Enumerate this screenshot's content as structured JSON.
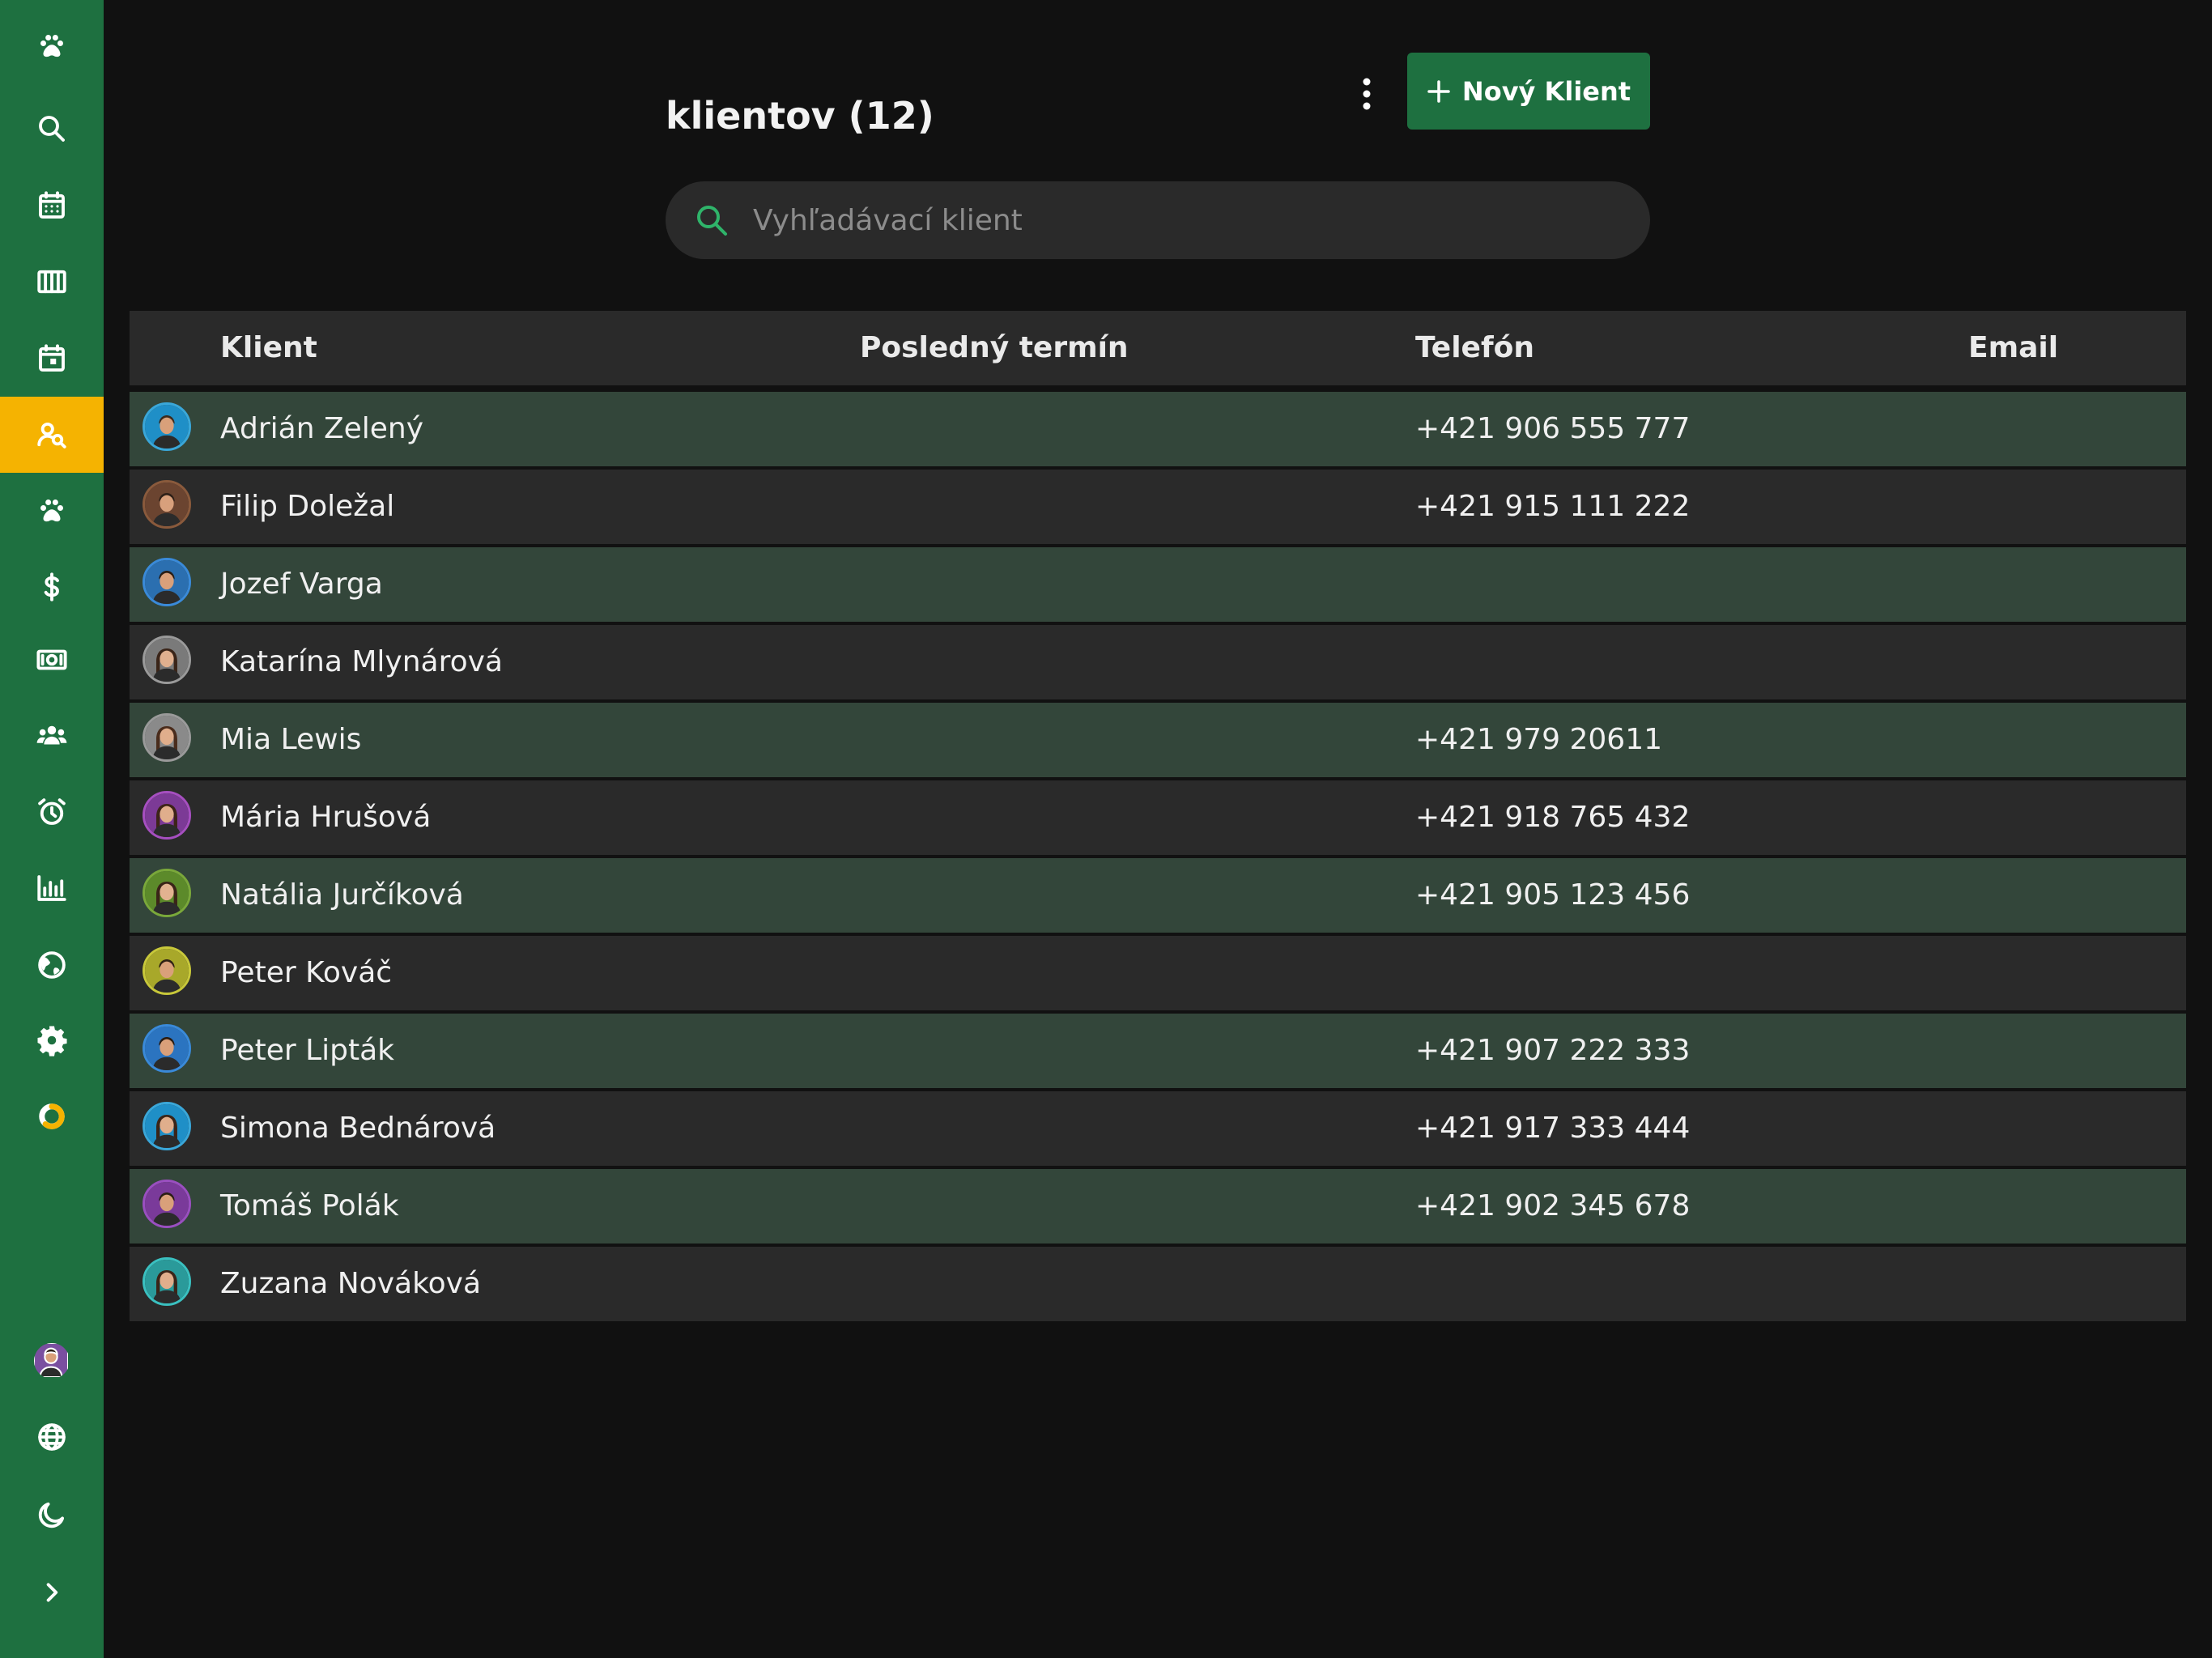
{
  "header": {
    "title": "klientov (12)",
    "new_button_label": "Nový Klient"
  },
  "search": {
    "placeholder": "Vyhľadávací klient",
    "value": ""
  },
  "sidebar": {
    "items": [
      {
        "name": "paw-logo-icon"
      },
      {
        "name": "search-icon"
      },
      {
        "name": "calendar-icon"
      },
      {
        "name": "columns-icon"
      },
      {
        "name": "calendar-day-icon"
      },
      {
        "name": "clients-icon",
        "active": true
      },
      {
        "name": "paw-icon"
      },
      {
        "name": "dollar-icon"
      },
      {
        "name": "money-bill-icon"
      },
      {
        "name": "users-icon"
      },
      {
        "name": "alarm-clock-icon"
      },
      {
        "name": "bar-chart-icon"
      },
      {
        "name": "globe-icon"
      },
      {
        "name": "gear-icon"
      },
      {
        "name": "donut-icon"
      },
      {
        "name": "user-avatar"
      },
      {
        "name": "language-globe-icon"
      },
      {
        "name": "moon-icon"
      },
      {
        "name": "expand-chevron-icon"
      }
    ],
    "active_color": "#f5b301",
    "background_color": "#1e7040"
  },
  "table": {
    "columns": [
      "Klient",
      "Posledný termín",
      "Telefón",
      "Email"
    ],
    "rows": [
      {
        "name": "Adrián Zelený",
        "last": "",
        "phone": "+421 906 555 777",
        "email": "",
        "ring": "#3aa7d9",
        "bg": "#1f8fc7",
        "skin": "#d9a07a",
        "hair": "#3b2a1e",
        "female": false
      },
      {
        "name": "Filip Doležal",
        "last": "",
        "phone": "+421 915 111 222",
        "email": "",
        "ring": "#8a5a3c",
        "bg": "#6b4430",
        "skin": "#d8a07c",
        "hair": "#2e2018",
        "female": false
      },
      {
        "name": "Jozef Varga",
        "last": "",
        "phone": "",
        "email": "",
        "ring": "#3a8ad9",
        "bg": "#2b6fb0",
        "skin": "#d9a07a",
        "hair": "#2a1d14",
        "female": false
      },
      {
        "name": "Katarína Mlynárová",
        "last": "",
        "phone": "",
        "email": "",
        "ring": "#9a9a9a",
        "bg": "#7a7a7a",
        "skin": "#e0b08f",
        "hair": "#3a2418",
        "female": true
      },
      {
        "name": "Mia Lewis",
        "last": "",
        "phone": "+421 979 20611",
        "email": "",
        "ring": "#9a9a9a",
        "bg": "#8a8a8a",
        "skin": "#e0ae8c",
        "hair": "#4a2c1c",
        "female": true
      },
      {
        "name": "Mária Hrušová",
        "last": "",
        "phone": "+421 918 765 432",
        "email": "",
        "ring": "#a64fc0",
        "bg": "#7c3a96",
        "skin": "#e0ae8c",
        "hair": "#3d2418",
        "female": true
      },
      {
        "name": "Natália Jurčíková",
        "last": "",
        "phone": "+421 905 123 456",
        "email": "",
        "ring": "#7aa83a",
        "bg": "#5c8a2a",
        "skin": "#e2b290",
        "hair": "#3a2418",
        "female": true
      },
      {
        "name": "Peter Kováč",
        "last": "",
        "phone": "",
        "email": "",
        "ring": "#c8c83a",
        "bg": "#a8a82a",
        "skin": "#d9a07a",
        "hair": "#2f2014",
        "female": false
      },
      {
        "name": "Peter Lipták",
        "last": "",
        "phone": "+421 907 222 333",
        "email": "",
        "ring": "#3a8ad9",
        "bg": "#2b74c0",
        "skin": "#d9a07a",
        "hair": "#2a1d14",
        "female": false
      },
      {
        "name": "Simona Bednárová",
        "last": "",
        "phone": "+421 917 333 444",
        "email": "",
        "ring": "#3aa7d9",
        "bg": "#1f8fc7",
        "skin": "#e0ae8c",
        "hair": "#3a2418",
        "female": true
      },
      {
        "name": "Tomáš Polák",
        "last": "",
        "phone": "+421 902 345 678",
        "email": "",
        "ring": "#9a4fc0",
        "bg": "#7a3a9a",
        "skin": "#d9a07a",
        "hair": "#2a1d14",
        "female": false
      },
      {
        "name": "Zuzana Nováková",
        "last": "",
        "phone": "",
        "email": "",
        "ring": "#3ac0c0",
        "bg": "#2a9a9a",
        "skin": "#e0ae8c",
        "hair": "#3a2418",
        "female": true
      }
    ]
  },
  "colors": {
    "accent_green": "#1e7040",
    "search_icon": "#2fb46a",
    "row_alt": "#33463a",
    "row": "#2a2a2a"
  }
}
